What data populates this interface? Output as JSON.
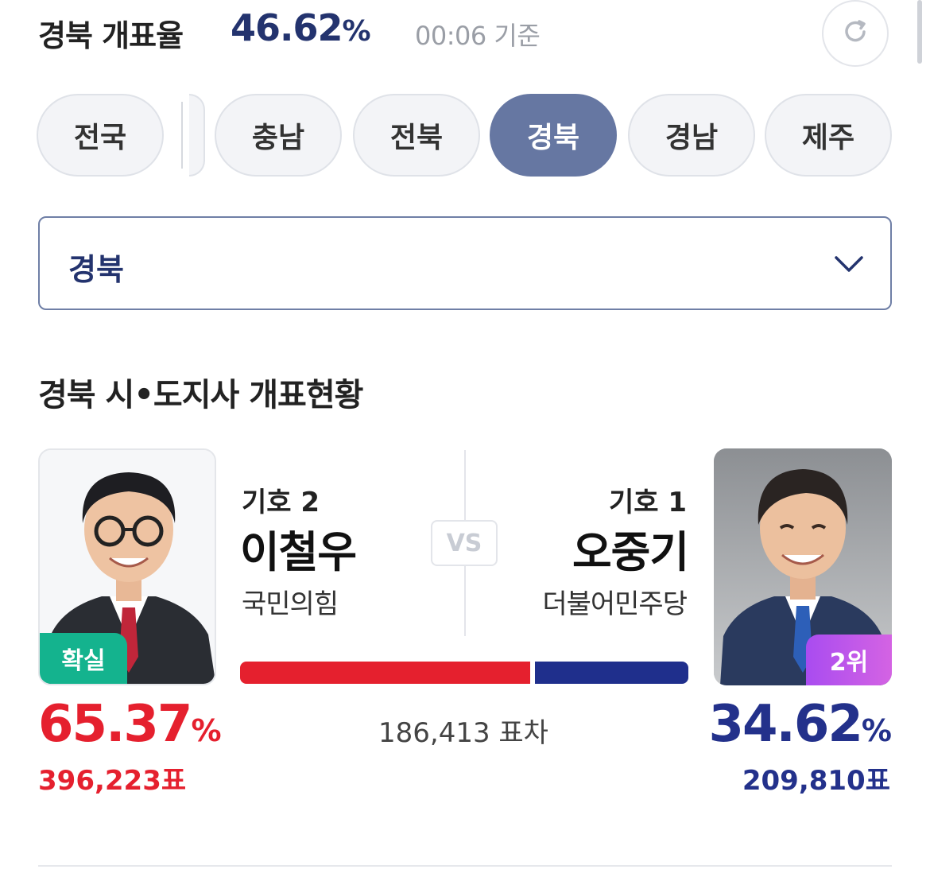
{
  "header": {
    "title": "경북 개표율",
    "rate_value": "46.62",
    "rate_unit": "%",
    "time_label": "00:06 기준",
    "refresh_icon": "refresh-icon"
  },
  "tabs": [
    {
      "label": "전국",
      "active": false
    },
    {
      "label": "충남",
      "active": false
    },
    {
      "label": "전북",
      "active": false
    },
    {
      "label": "경북",
      "active": true
    },
    {
      "label": "경남",
      "active": false
    },
    {
      "label": "제주",
      "active": false
    }
  ],
  "region_select": {
    "value": "경북",
    "icon": "chevron-down-icon"
  },
  "section_title": "경북 시•도지사 개표현황",
  "vs_label": "VS",
  "candidates": {
    "left": {
      "number_label": "기호 2",
      "name": "이철우",
      "party": "국민의힘",
      "badge": "확실",
      "percent": "65.37",
      "percent_unit": "%",
      "votes": "396,223표",
      "color": "#e5202e"
    },
    "right": {
      "number_label": "기호 1",
      "name": "오중기",
      "party": "더불어민주당",
      "badge": "2위",
      "percent": "34.62",
      "percent_unit": "%",
      "votes": "209,810표",
      "color": "#23318b"
    }
  },
  "vote_bar": {
    "left_share": 65.37,
    "right_share": 34.62
  },
  "difference_label": "186,413 표차",
  "colors": {
    "accent": "#23336e",
    "active_tab": "#6677a2",
    "confirmed_badge": "#14b38e"
  }
}
